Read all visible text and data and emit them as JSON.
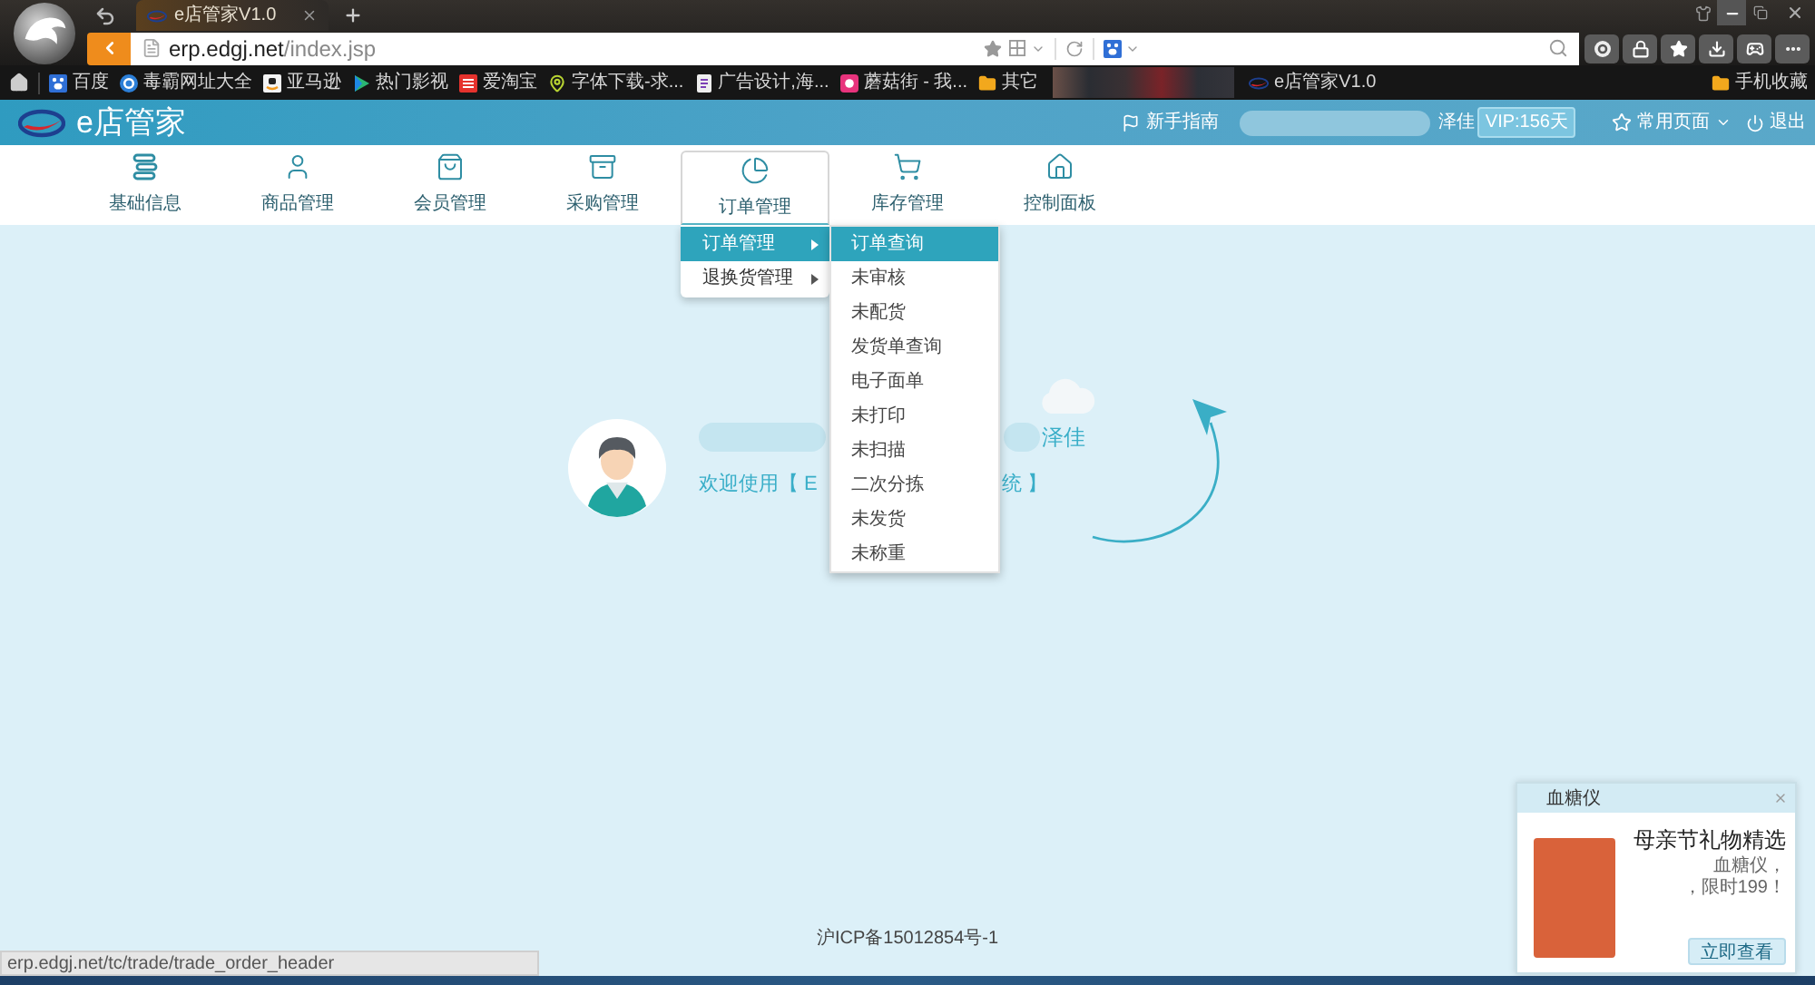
{
  "browser": {
    "tabs": [
      {
        "title": "e店管家V1.0",
        "selected": true
      }
    ],
    "address": {
      "domain": "erp.edgj.net",
      "path": "/index.jsp"
    },
    "bookmarks": [
      {
        "label": "百度"
      },
      {
        "label": "毒霸网址大全"
      },
      {
        "label": "亚马逊"
      },
      {
        "label": "热门影视"
      },
      {
        "label": "爱淘宝"
      },
      {
        "label": "字体下载-求..."
      },
      {
        "label": "广告设计,海..."
      },
      {
        "label": "蘑菇街 - 我..."
      },
      {
        "label": "其它"
      }
    ],
    "bookmarks_more": [
      {
        "label": "e店管家V1.0"
      }
    ],
    "mobile_bookmarks": "手机收藏"
  },
  "header": {
    "logo": "e店管家",
    "guide": "新手指南",
    "user_suffix": "泽佳",
    "vip": "VIP:156天",
    "favorites": "常用页面",
    "logout": "退出"
  },
  "nav": [
    {
      "label": "基础信息",
      "selected": false
    },
    {
      "label": "商品管理",
      "selected": false
    },
    {
      "label": "会员管理",
      "selected": false
    },
    {
      "label": "采购管理",
      "selected": false
    },
    {
      "label": "订单管理",
      "selected": true
    },
    {
      "label": "库存管理",
      "selected": false
    },
    {
      "label": "控制面板",
      "selected": false
    }
  ],
  "menu": [
    {
      "label": "订单管理",
      "selected": true,
      "has_submenu": true
    },
    {
      "label": "退换货管理",
      "selected": false,
      "has_submenu": true
    }
  ],
  "submenu": [
    {
      "label": "订单查询",
      "selected": true
    },
    {
      "label": "未审核",
      "selected": false
    },
    {
      "label": "未配货",
      "selected": false
    },
    {
      "label": "发货单查询",
      "selected": false
    },
    {
      "label": "电子面单",
      "selected": false
    },
    {
      "label": "未打印",
      "selected": false
    },
    {
      "label": "未扫描",
      "selected": false
    },
    {
      "label": "二次分拣",
      "selected": false
    },
    {
      "label": "未发货",
      "selected": false
    },
    {
      "label": "未称重",
      "selected": false
    }
  ],
  "welcome": {
    "name_suffix": "泽佳",
    "greeting_start": "欢迎使用【 E",
    "greeting_end": "统 】"
  },
  "footer": {
    "icp": "沪ICP备15012854号-1"
  },
  "status_bar": "erp.edgj.net/tc/trade/trade_order_header",
  "popup": {
    "title": "血糖仪",
    "headline": "母亲节礼物精选",
    "lines": [
      "血糖仪，",
      "，限时199！"
    ],
    "button": "立即查看"
  }
}
